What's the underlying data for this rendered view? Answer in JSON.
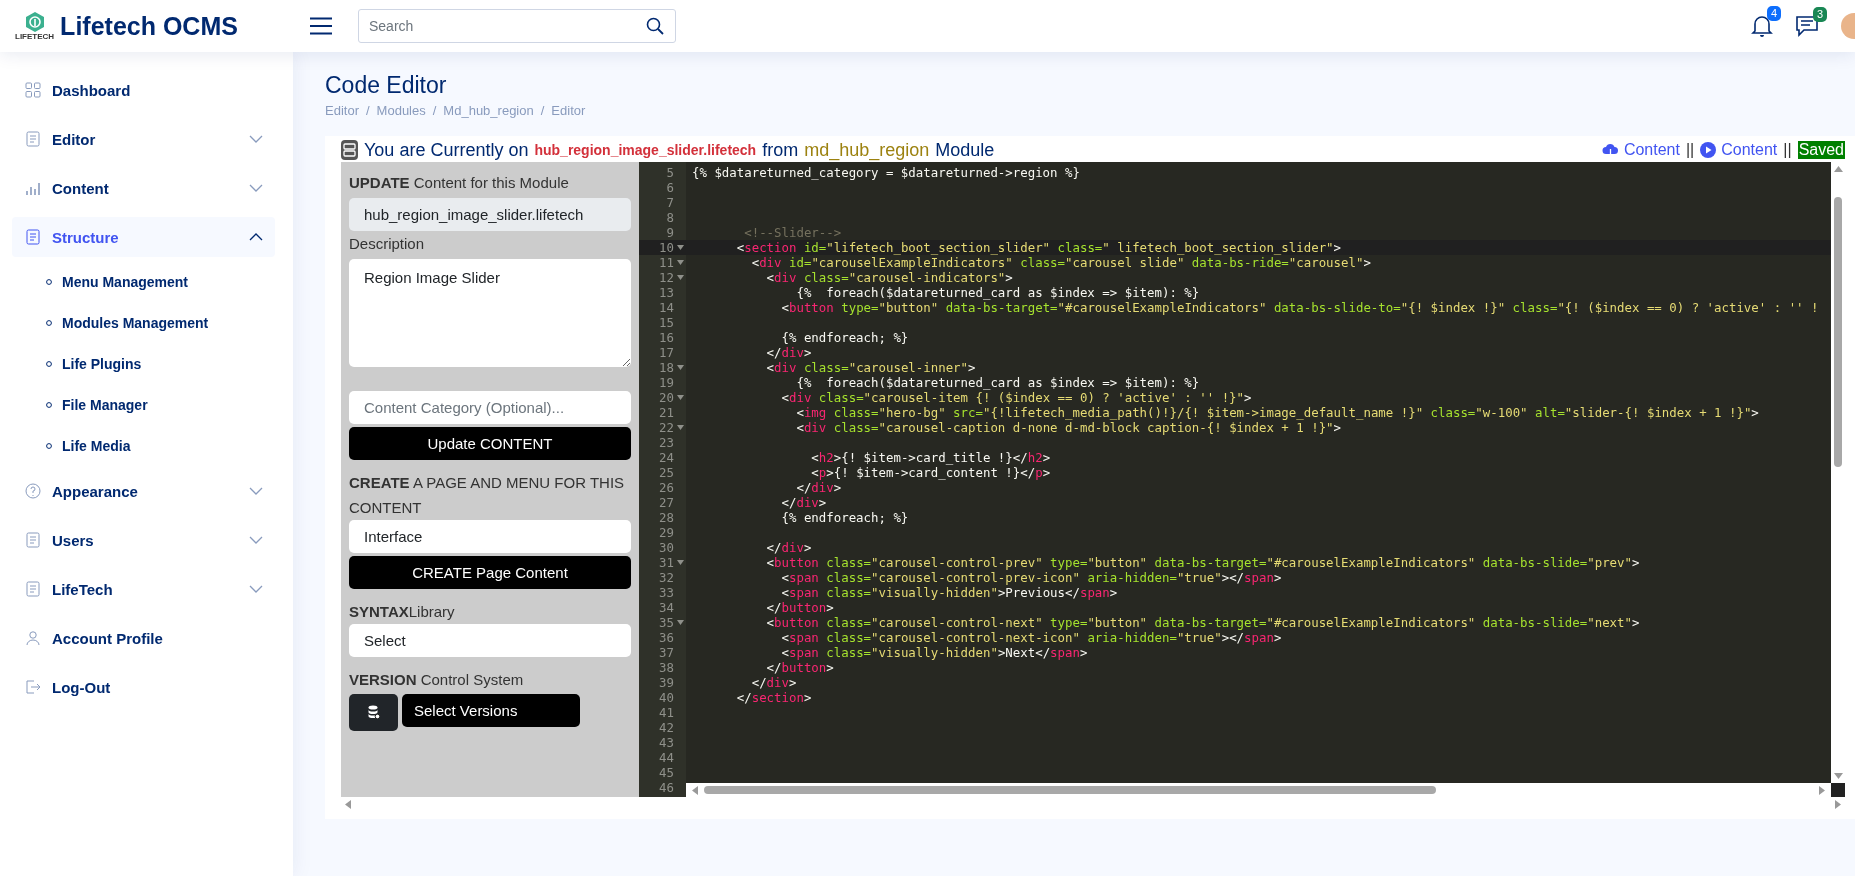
{
  "header": {
    "logo_caption": "LIFETECH",
    "brand": "Lifetech OCMS",
    "search": {
      "placeholder": "Search"
    },
    "notifications": [
      {
        "kind": "bell",
        "count": "4",
        "color": "#0d6efd"
      },
      {
        "kind": "chat",
        "count": "3",
        "color": "#198754"
      }
    ]
  },
  "sidebar": {
    "items": [
      {
        "label": "Dashboard",
        "kind": "link",
        "selected": false
      },
      {
        "label": "Editor",
        "kind": "group",
        "expanded": false,
        "selected": false
      },
      {
        "label": "Content",
        "kind": "group",
        "expanded": false,
        "selected": false
      },
      {
        "label": "Structure",
        "kind": "group",
        "expanded": true,
        "selected": true,
        "children": [
          {
            "label": "Menu Management"
          },
          {
            "label": "Modules Management"
          },
          {
            "label": "Life Plugins"
          },
          {
            "label": "File Manager"
          },
          {
            "label": "Life Media"
          }
        ]
      },
      {
        "label": "Appearance",
        "kind": "group",
        "expanded": false,
        "selected": false
      },
      {
        "label": "Users",
        "kind": "group",
        "expanded": false,
        "selected": false
      },
      {
        "label": "LifeTech",
        "kind": "group",
        "expanded": false,
        "selected": false
      },
      {
        "label": "Account Profile",
        "kind": "link",
        "selected": false
      },
      {
        "label": "Log-Out",
        "kind": "link",
        "selected": false
      }
    ]
  },
  "page": {
    "title": "Code Editor",
    "breadcrumb": {
      "separator": "/",
      "items": [
        "Editor",
        "Modules",
        "Md_hub_region",
        "Editor"
      ]
    }
  },
  "editor_header": {
    "intro": "You are Currently on",
    "file": "hub_region_image_slider.lifetech",
    "from": "from",
    "module": "md_hub_region",
    "suffix": "Module",
    "actions": [
      {
        "kind": "download",
        "label": "Content"
      },
      {
        "kind": "separator",
        "label": "||"
      },
      {
        "kind": "play",
        "label": "Content"
      },
      {
        "kind": "separator",
        "label": "||"
      },
      {
        "kind": "status",
        "label": "Saved"
      }
    ]
  },
  "panel": {
    "update_label": "**UPDATE** Content for this Module",
    "file_field": {
      "value": "hub_region_image_slider.lifetech"
    },
    "description_label": "Description",
    "description": {
      "value": "Region Image Slider"
    },
    "category_field": {
      "placeholder": "Content Category (Optional)..."
    },
    "update_button": "Update CONTENT",
    "create_label": "**CREATE** A PAGE AND MENU FOR THIS CONTENT",
    "page_field": {
      "value": "Interface"
    },
    "create_button": "CREATE Page Content",
    "syntax_label": "**SYNTAX**Library",
    "syntax_select": "Select",
    "version_label": "**VERSION** Control System",
    "version_select": "Select Versions"
  },
  "code": {
    "lines": [
      {
        "n": "5",
        "fold": false,
        "current": false,
        "tokens": [
          {
            "kind": "text",
            "text": "{% $datareturned_category = $datareturned->region %}"
          }
        ]
      },
      {
        "n": "6",
        "fold": false,
        "current": false
      },
      {
        "n": "7",
        "fold": false,
        "current": false
      },
      {
        "n": "8",
        "fold": false,
        "current": false
      },
      {
        "n": "9",
        "fold": false,
        "current": false,
        "tokens": [
          {
            "kind": "comment",
            "text": "       <!--Slider-->"
          }
        ]
      },
      {
        "n": "10",
        "fold": true,
        "current": true,
        "tokens": [
          {
            "kind": "punct",
            "text": "      <"
          },
          {
            "kind": "tag",
            "text": "section"
          },
          {
            "kind": "attr",
            "text": " id="
          },
          {
            "kind": "string",
            "text": "\"lifetech_boot_section_slider\""
          },
          {
            "kind": "attr",
            "text": " class="
          },
          {
            "kind": "string",
            "text": "\" lifetech_boot_section_slider\""
          },
          {
            "kind": "punct",
            "text": ">"
          }
        ]
      },
      {
        "n": "11",
        "fold": true,
        "current": false,
        "tokens": [
          {
            "kind": "punct",
            "text": "        <"
          },
          {
            "kind": "tag",
            "text": "div"
          },
          {
            "kind": "attr",
            "text": " id="
          },
          {
            "kind": "string",
            "text": "\"carouselExampleIndicators\""
          },
          {
            "kind": "attr",
            "text": " class="
          },
          {
            "kind": "string",
            "text": "\"carousel slide\""
          },
          {
            "kind": "attr",
            "text": " data-bs-ride="
          },
          {
            "kind": "string",
            "text": "\"carousel\""
          },
          {
            "kind": "punct",
            "text": ">"
          }
        ]
      },
      {
        "n": "12",
        "fold": true,
        "current": false,
        "tokens": [
          {
            "kind": "punct",
            "text": "          <"
          },
          {
            "kind": "tag",
            "text": "div"
          },
          {
            "kind": "attr",
            "text": " class="
          },
          {
            "kind": "string",
            "text": "\"carousel-indicators\""
          },
          {
            "kind": "punct",
            "text": ">"
          }
        ]
      },
      {
        "n": "13",
        "fold": false,
        "current": false,
        "tokens": [
          {
            "kind": "text",
            "text": "              {%  foreach($datareturned_card as $index => $item): %}"
          }
        ]
      },
      {
        "n": "14",
        "fold": false,
        "current": false,
        "tokens": [
          {
            "kind": "punct",
            "text": "            <"
          },
          {
            "kind": "tag",
            "text": "button"
          },
          {
            "kind": "attr",
            "text": " type="
          },
          {
            "kind": "string",
            "text": "\"button\""
          },
          {
            "kind": "attr",
            "text": " data-bs-target="
          },
          {
            "kind": "string",
            "text": "\"#carouselExampleIndicators\""
          },
          {
            "kind": "attr",
            "text": " data-bs-slide-to="
          },
          {
            "kind": "string",
            "text": "\"{! $index !}\""
          },
          {
            "kind": "attr",
            "text": " class="
          },
          {
            "kind": "string",
            "text": "\"{! ($index == 0) ? 'active' : '' !"
          }
        ]
      },
      {
        "n": "15",
        "fold": false,
        "current": false
      },
      {
        "n": "16",
        "fold": false,
        "current": false,
        "tokens": [
          {
            "kind": "text",
            "text": "            {% endforeach; %}"
          }
        ]
      },
      {
        "n": "17",
        "fold": false,
        "current": false,
        "tokens": [
          {
            "kind": "punct",
            "text": "          </"
          },
          {
            "kind": "tag",
            "text": "div"
          },
          {
            "kind": "punct",
            "text": ">"
          }
        ]
      },
      {
        "n": "18",
        "fold": true,
        "current": false,
        "tokens": [
          {
            "kind": "punct",
            "text": "          <"
          },
          {
            "kind": "tag",
            "text": "div"
          },
          {
            "kind": "attr",
            "text": " class="
          },
          {
            "kind": "string",
            "text": "\"carousel-inner\""
          },
          {
            "kind": "punct",
            "text": ">"
          }
        ]
      },
      {
        "n": "19",
        "fold": false,
        "current": false,
        "tokens": [
          {
            "kind": "text",
            "text": "              {%  foreach($datareturned_card as $index => $item): %}"
          }
        ]
      },
      {
        "n": "20",
        "fold": true,
        "current": false,
        "tokens": [
          {
            "kind": "punct",
            "text": "            <"
          },
          {
            "kind": "tag",
            "text": "div"
          },
          {
            "kind": "attr",
            "text": " class="
          },
          {
            "kind": "string",
            "text": "\"carousel-item {! ($index == 0) ? 'active' : '' !}\""
          },
          {
            "kind": "punct",
            "text": ">"
          }
        ]
      },
      {
        "n": "21",
        "fold": false,
        "current": false,
        "tokens": [
          {
            "kind": "punct",
            "text": "              <"
          },
          {
            "kind": "tag",
            "text": "img"
          },
          {
            "kind": "attr",
            "text": " class="
          },
          {
            "kind": "string",
            "text": "\"hero-bg\""
          },
          {
            "kind": "attr",
            "text": " src="
          },
          {
            "kind": "string",
            "text": "\"{!lifetech_media_path()!}/{! $item->image_default_name !}\""
          },
          {
            "kind": "attr",
            "text": " class="
          },
          {
            "kind": "string",
            "text": "\"w-100\""
          },
          {
            "kind": "attr",
            "text": " alt="
          },
          {
            "kind": "string",
            "text": "\"slider-{! $index + 1 !}\""
          },
          {
            "kind": "punct",
            "text": ">"
          }
        ]
      },
      {
        "n": "22",
        "fold": true,
        "current": false,
        "tokens": [
          {
            "kind": "punct",
            "text": "              <"
          },
          {
            "kind": "tag",
            "text": "div"
          },
          {
            "kind": "attr",
            "text": " class="
          },
          {
            "kind": "string",
            "text": "\"carousel-caption d-none d-md-block caption-{! $index + 1 !}\""
          },
          {
            "kind": "punct",
            "text": ">"
          }
        ]
      },
      {
        "n": "23",
        "fold": false,
        "current": false
      },
      {
        "n": "24",
        "fold": false,
        "current": false,
        "tokens": [
          {
            "kind": "punct",
            "text": "                <"
          },
          {
            "kind": "tag",
            "text": "h2"
          },
          {
            "kind": "punct",
            "text": ">"
          },
          {
            "kind": "text",
            "text": "{! $item->card_title !}"
          },
          {
            "kind": "punct",
            "text": "</"
          },
          {
            "kind": "tag",
            "text": "h2"
          },
          {
            "kind": "punct",
            "text": ">"
          }
        ]
      },
      {
        "n": "25",
        "fold": false,
        "current": false,
        "tokens": [
          {
            "kind": "punct",
            "text": "                <"
          },
          {
            "kind": "tag",
            "text": "p"
          },
          {
            "kind": "punct",
            "text": ">"
          },
          {
            "kind": "text",
            "text": "{! $item->card_content !}"
          },
          {
            "kind": "punct",
            "text": "</"
          },
          {
            "kind": "tag",
            "text": "p"
          },
          {
            "kind": "punct",
            "text": ">"
          }
        ]
      },
      {
        "n": "26",
        "fold": false,
        "current": false,
        "tokens": [
          {
            "kind": "punct",
            "text": "              </"
          },
          {
            "kind": "tag",
            "text": "div"
          },
          {
            "kind": "punct",
            "text": ">"
          }
        ]
      },
      {
        "n": "27",
        "fold": false,
        "current": false,
        "tokens": [
          {
            "kind": "punct",
            "text": "            </"
          },
          {
            "kind": "tag",
            "text": "div"
          },
          {
            "kind": "punct",
            "text": ">"
          }
        ]
      },
      {
        "n": "28",
        "fold": false,
        "current": false,
        "tokens": [
          {
            "kind": "text",
            "text": "            {% endforeach; %}"
          }
        ]
      },
      {
        "n": "29",
        "fold": false,
        "current": false
      },
      {
        "n": "30",
        "fold": false,
        "current": false,
        "tokens": [
          {
            "kind": "punct",
            "text": "          </"
          },
          {
            "kind": "tag",
            "text": "div"
          },
          {
            "kind": "punct",
            "text": ">"
          }
        ]
      },
      {
        "n": "31",
        "fold": true,
        "current": false,
        "tokens": [
          {
            "kind": "punct",
            "text": "          <"
          },
          {
            "kind": "tag",
            "text": "button"
          },
          {
            "kind": "attr",
            "text": " class="
          },
          {
            "kind": "string",
            "text": "\"carousel-control-prev\""
          },
          {
            "kind": "attr",
            "text": " type="
          },
          {
            "kind": "string",
            "text": "\"button\""
          },
          {
            "kind": "attr",
            "text": " data-bs-target="
          },
          {
            "kind": "string",
            "text": "\"#carouselExampleIndicators\""
          },
          {
            "kind": "attr",
            "text": " data-bs-slide="
          },
          {
            "kind": "string",
            "text": "\"prev\""
          },
          {
            "kind": "punct",
            "text": ">"
          }
        ]
      },
      {
        "n": "32",
        "fold": false,
        "current": false,
        "tokens": [
          {
            "kind": "punct",
            "text": "            <"
          },
          {
            "kind": "tag",
            "text": "span"
          },
          {
            "kind": "attr",
            "text": " class="
          },
          {
            "kind": "string",
            "text": "\"carousel-control-prev-icon\""
          },
          {
            "kind": "attr",
            "text": " aria-hidden="
          },
          {
            "kind": "string",
            "text": "\"true\""
          },
          {
            "kind": "punct",
            "text": "></"
          },
          {
            "kind": "tag",
            "text": "span"
          },
          {
            "kind": "punct",
            "text": ">"
          }
        ]
      },
      {
        "n": "33",
        "fold": false,
        "current": false,
        "tokens": [
          {
            "kind": "punct",
            "text": "            <"
          },
          {
            "kind": "tag",
            "text": "span"
          },
          {
            "kind": "attr",
            "text": " class="
          },
          {
            "kind": "string",
            "text": "\"visually-hidden\""
          },
          {
            "kind": "punct",
            "text": ">"
          },
          {
            "kind": "text",
            "text": "Previous"
          },
          {
            "kind": "punct",
            "text": "</"
          },
          {
            "kind": "tag",
            "text": "span"
          },
          {
            "kind": "punct",
            "text": ">"
          }
        ]
      },
      {
        "n": "34",
        "fold": false,
        "current": false,
        "tokens": [
          {
            "kind": "punct",
            "text": "          </"
          },
          {
            "kind": "tag",
            "text": "button"
          },
          {
            "kind": "punct",
            "text": ">"
          }
        ]
      },
      {
        "n": "35",
        "fold": true,
        "current": false,
        "tokens": [
          {
            "kind": "punct",
            "text": "          <"
          },
          {
            "kind": "tag",
            "text": "button"
          },
          {
            "kind": "attr",
            "text": " class="
          },
          {
            "kind": "string",
            "text": "\"carousel-control-next\""
          },
          {
            "kind": "attr",
            "text": " type="
          },
          {
            "kind": "string",
            "text": "\"button\""
          },
          {
            "kind": "attr",
            "text": " data-bs-target="
          },
          {
            "kind": "string",
            "text": "\"#carouselExampleIndicators\""
          },
          {
            "kind": "attr",
            "text": " data-bs-slide="
          },
          {
            "kind": "string",
            "text": "\"next\""
          },
          {
            "kind": "punct",
            "text": ">"
          }
        ]
      },
      {
        "n": "36",
        "fold": false,
        "current": false,
        "tokens": [
          {
            "kind": "punct",
            "text": "            <"
          },
          {
            "kind": "tag",
            "text": "span"
          },
          {
            "kind": "attr",
            "text": " class="
          },
          {
            "kind": "string",
            "text": "\"carousel-control-next-icon\""
          },
          {
            "kind": "attr",
            "text": " aria-hidden="
          },
          {
            "kind": "string",
            "text": "\"true\""
          },
          {
            "kind": "punct",
            "text": "></"
          },
          {
            "kind": "tag",
            "text": "span"
          },
          {
            "kind": "punct",
            "text": ">"
          }
        ]
      },
      {
        "n": "37",
        "fold": false,
        "current": false,
        "tokens": [
          {
            "kind": "punct",
            "text": "            <"
          },
          {
            "kind": "tag",
            "text": "span"
          },
          {
            "kind": "attr",
            "text": " class="
          },
          {
            "kind": "string",
            "text": "\"visually-hidden\""
          },
          {
            "kind": "punct",
            "text": ">"
          },
          {
            "kind": "text",
            "text": "Next"
          },
          {
            "kind": "punct",
            "text": "</"
          },
          {
            "kind": "tag",
            "text": "span"
          },
          {
            "kind": "punct",
            "text": ">"
          }
        ]
      },
      {
        "n": "38",
        "fold": false,
        "current": false,
        "tokens": [
          {
            "kind": "punct",
            "text": "          </"
          },
          {
            "kind": "tag",
            "text": "button"
          },
          {
            "kind": "punct",
            "text": ">"
          }
        ]
      },
      {
        "n": "39",
        "fold": false,
        "current": false,
        "tokens": [
          {
            "kind": "punct",
            "text": "        </"
          },
          {
            "kind": "tag",
            "text": "div"
          },
          {
            "kind": "punct",
            "text": ">"
          }
        ]
      },
      {
        "n": "40",
        "fold": false,
        "current": false,
        "tokens": [
          {
            "kind": "punct",
            "text": "      </"
          },
          {
            "kind": "tag",
            "text": "section"
          },
          {
            "kind": "punct",
            "text": ">"
          }
        ]
      },
      {
        "n": "41",
        "fold": false,
        "current": false
      },
      {
        "n": "42",
        "fold": false,
        "current": false
      },
      {
        "n": "43",
        "fold": false,
        "current": false
      },
      {
        "n": "44",
        "fold": false,
        "current": false
      },
      {
        "n": "45",
        "fold": false,
        "current": false
      },
      {
        "n": "46",
        "fold": false,
        "current": false
      }
    ]
  }
}
